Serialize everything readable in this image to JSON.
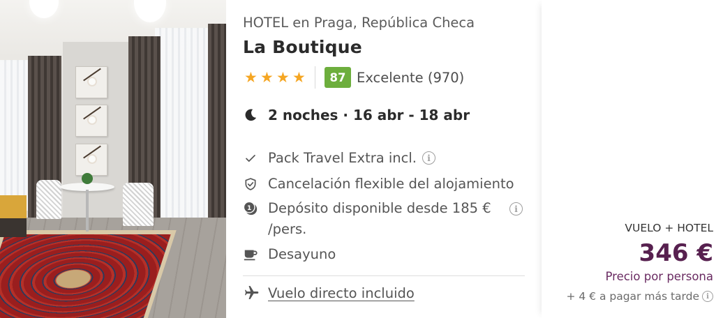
{
  "photo": {
    "alt_icon": "hotel-room-photo"
  },
  "hotel": {
    "location": "HOTEL en Praga, República Checa",
    "name": "La Boutique",
    "stars": 4,
    "star_glyph": "★",
    "score": "87",
    "score_label": "Excelente (970)",
    "score_color": "#6dae3d"
  },
  "stay": {
    "dates": "2 noches · 16 abr - 18 abr",
    "icon": "moon-icon"
  },
  "features": [
    {
      "icon": "check-icon",
      "text": "Pack Travel Extra incl.",
      "info": true
    },
    {
      "icon": "shield-check-icon",
      "text": "Cancelación flexible del alojamiento",
      "info": false
    },
    {
      "icon": "deposit-coins-icon",
      "text": "Depósito disponible desde 185 €",
      "text2": "/pers.",
      "info": true
    },
    {
      "icon": "coffee-cup-icon",
      "text": "Desayuno",
      "info": false
    }
  ],
  "flight": {
    "icon": "airplane-icon",
    "text": "Vuelo directo incluido"
  },
  "price": {
    "package": "VUELO + HOTEL",
    "amount": "346 €",
    "per": "Precio por persona",
    "extra": "+ 4 € a pagar más tarde",
    "accent": "#57204f"
  },
  "info_glyph": "i"
}
